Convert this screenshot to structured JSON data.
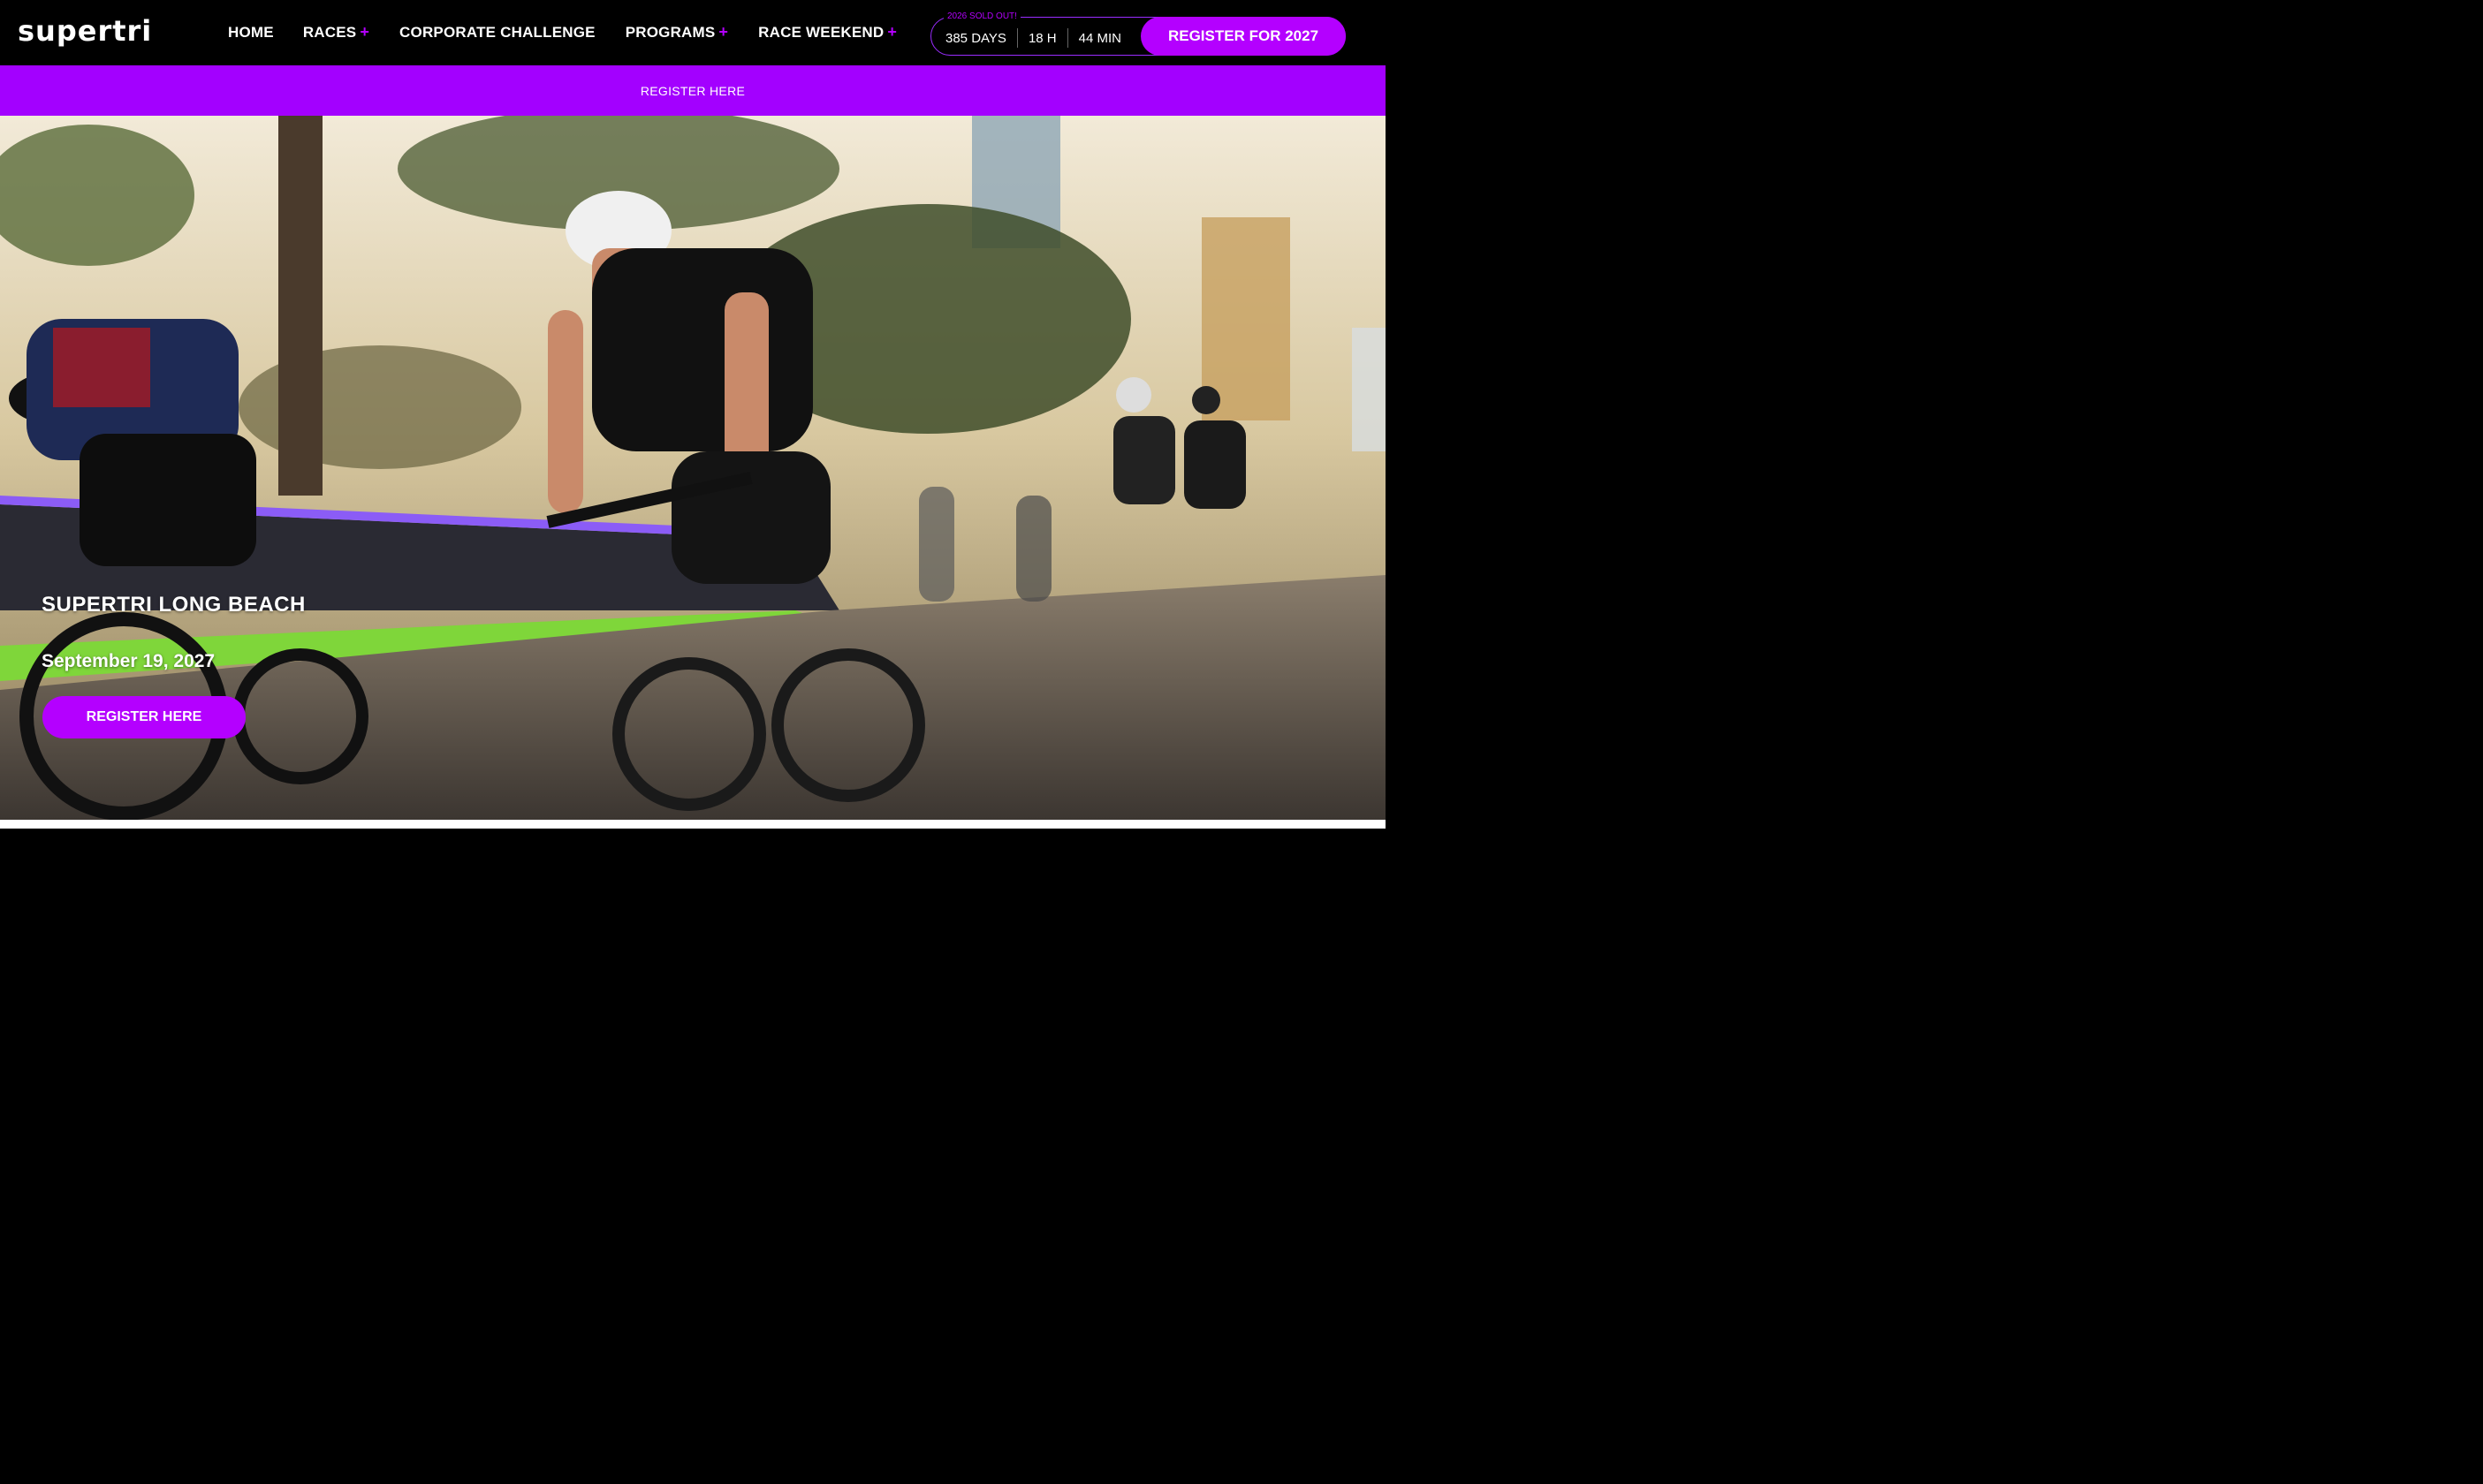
{
  "brand": {
    "logo_text": "supertri"
  },
  "nav": {
    "items": [
      {
        "label": "HOME",
        "has_submenu": false
      },
      {
        "label": "RACES",
        "has_submenu": true
      },
      {
        "label": "CORPORATE CHALLENGE",
        "has_submenu": false
      },
      {
        "label": "PROGRAMS",
        "has_submenu": true
      },
      {
        "label": "RACE WEEKEND",
        "has_submenu": true
      }
    ],
    "submenu_glyph": "+"
  },
  "countdown": {
    "notice": "2026 SOLD OUT!",
    "days": "385 DAYS",
    "hours": "18 H",
    "minutes": "44 MIN"
  },
  "header_cta": {
    "label": "REGISTER FOR 2027"
  },
  "banner": {
    "link_label": "REGISTER HERE"
  },
  "hero": {
    "title": "SUPERTRI LONG BEACH",
    "date": "September 19, 2027",
    "cta_label": "REGISTER HERE",
    "image_alt_icon": "cyclists-photo"
  },
  "colors": {
    "accent": "#b400ff",
    "banner": "#a300ff",
    "topbar": "#000000",
    "text": "#ffffff"
  }
}
